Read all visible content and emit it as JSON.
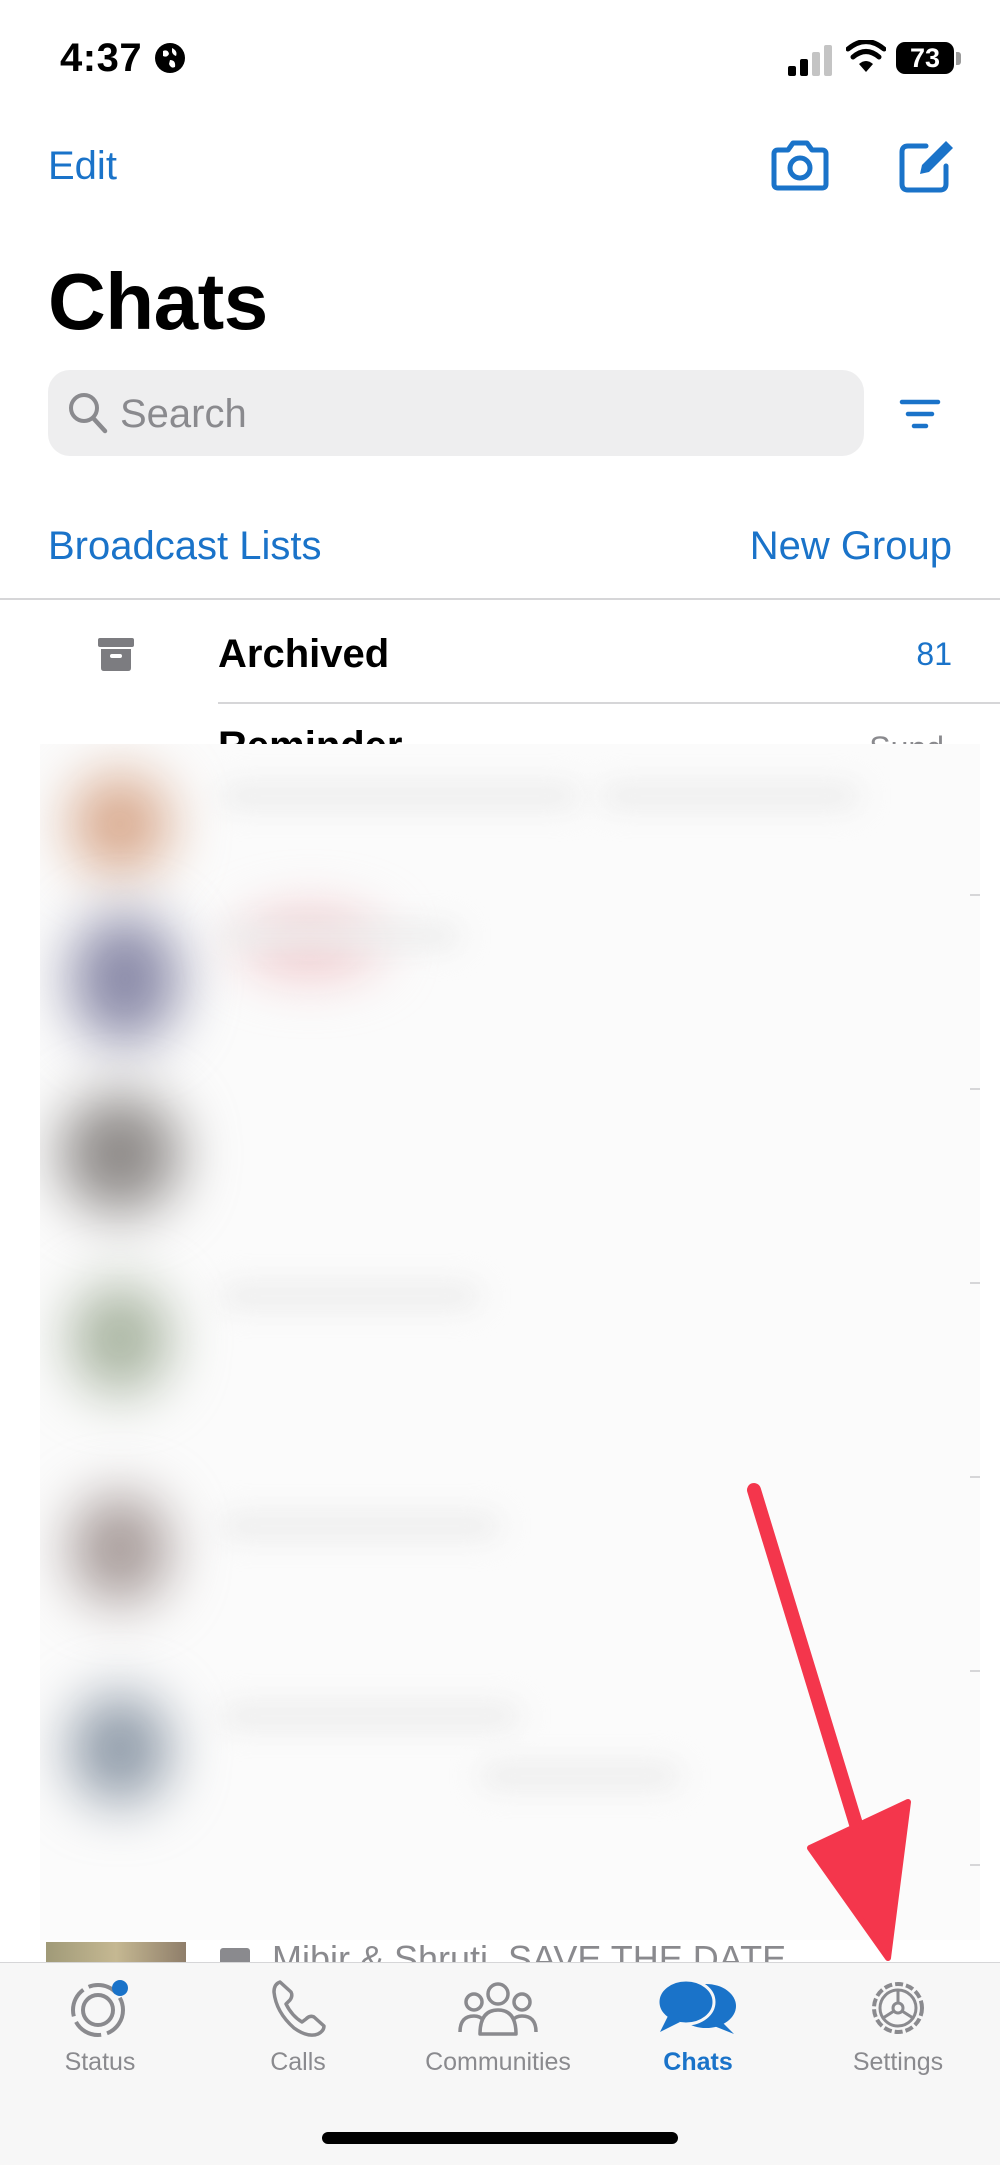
{
  "status_bar": {
    "time": "4:37",
    "battery": "73"
  },
  "header": {
    "edit_label": "Edit",
    "title": "Chats"
  },
  "search": {
    "placeholder": "Search"
  },
  "links": {
    "broadcast": "Broadcast Lists",
    "new_group": "New Group"
  },
  "archived": {
    "label": "Archived",
    "count": "81"
  },
  "reminder": {
    "name": "Reminder",
    "time": "Sund"
  },
  "partial_row": {
    "preview": "Mibir & Shruti, SAVE THE DATE"
  },
  "tabs": [
    {
      "label": "Status"
    },
    {
      "label": "Calls"
    },
    {
      "label": "Communities"
    },
    {
      "label": "Chats"
    },
    {
      "label": "Settings"
    }
  ],
  "colors": {
    "accent": "#1a73c9",
    "annotation_arrow": "#f4364c",
    "secondary_text": "#8a8a8e"
  }
}
